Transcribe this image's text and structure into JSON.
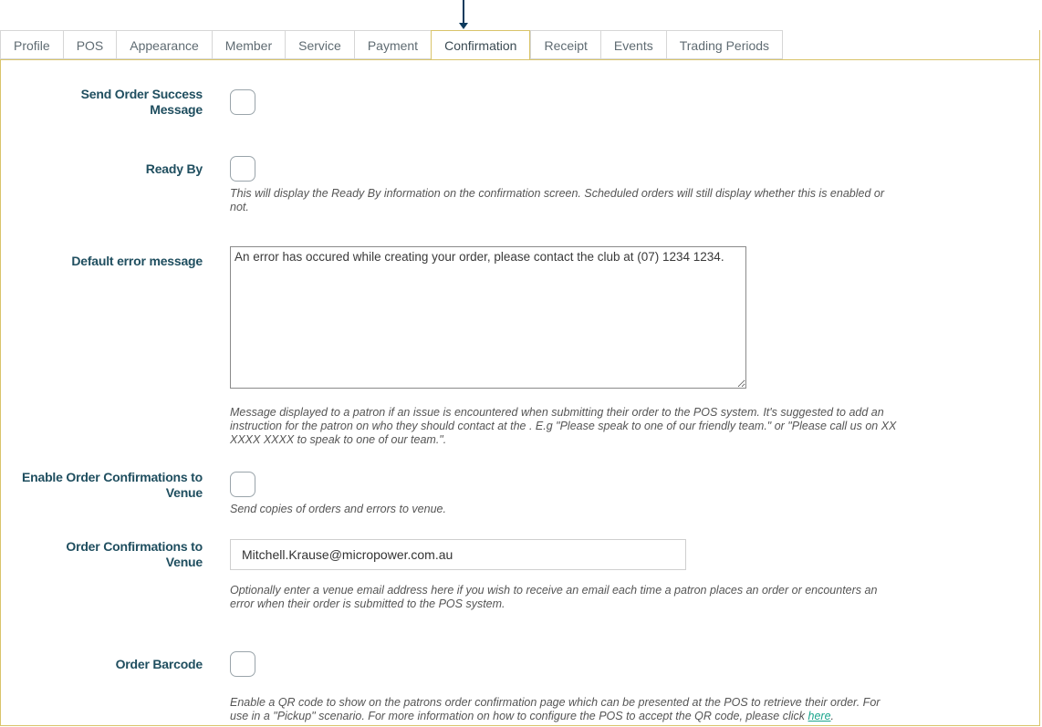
{
  "tabs": [
    {
      "label": "Profile"
    },
    {
      "label": "POS"
    },
    {
      "label": "Appearance"
    },
    {
      "label": "Member"
    },
    {
      "label": "Service"
    },
    {
      "label": "Payment"
    },
    {
      "label": "Confirmation",
      "active": true
    },
    {
      "label": "Receipt"
    },
    {
      "label": "Events"
    },
    {
      "label": "Trading Periods"
    }
  ],
  "form": {
    "send_order_success": {
      "label": "Send Order Success Message",
      "checked": false
    },
    "ready_by": {
      "label": "Ready By",
      "checked": false,
      "help": "This will display the Ready By information on the confirmation screen. Scheduled orders will still display whether this is enabled or not."
    },
    "default_error": {
      "label": "Default error message",
      "value": "An error has occured while creating your order, please contact the club at (07) 1234 1234.",
      "help": "Message displayed to a patron if an issue is encountered when submitting their order to the POS system. It's suggested to add an instruction for the patron on who they should contact at the . E.g \"Please speak to one of our friendly team.\" or \"Please call us on XX XXXX XXXX to speak to one of our team.\"."
    },
    "enable_confirmations": {
      "label": "Enable Order Confirmations to Venue",
      "checked": false,
      "help": "Send copies of orders and errors to venue."
    },
    "confirmations_email": {
      "label": "Order Confirmations to Venue",
      "value": "Mitchell.Krause@micropower.com.au",
      "help": "Optionally enter a venue email address here if you wish to receive an email each time a patron places an order or encounters an error when their order is submitted to the POS system."
    },
    "order_barcode": {
      "label": "Order Barcode",
      "checked": false,
      "help": "Enable a QR code to show on the patrons order confirmation page which can be presented at the POS to retrieve their order. For use in a \"Pickup\" scenario. For more information on how to configure the POS to accept the QR code, please click",
      "link_text": "here",
      "help_end": "."
    }
  },
  "colors": {
    "accent_border": "#d9c46a",
    "label": "#1f4e5f",
    "link": "#1aa58c",
    "arrow": "#0d3b5e"
  }
}
